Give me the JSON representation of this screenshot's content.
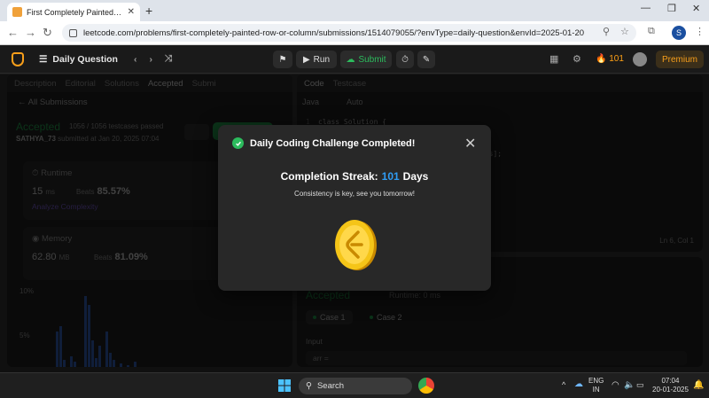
{
  "browser": {
    "tab_title": "First Completely Painted Row o",
    "url": "leetcode.com/problems/first-completely-painted-row-or-column/submissions/1514079055/?envType=daily-question&envId=2025-01-20",
    "profile_initial": "S"
  },
  "header": {
    "title": "Daily Question",
    "run_label": "Run",
    "submit_label": "Submit",
    "streak_count": "101",
    "premium_label": "Premium"
  },
  "left_panel": {
    "tabs": [
      "Description",
      "Editorial",
      "Solutions",
      "Accepted",
      "Submi"
    ],
    "all_submissions": "All Submissions",
    "status": "Accepted",
    "testcases": "1056 / 1056 testcases passed",
    "user": "SATHYA_73",
    "submitted_at": "submitted at Jan 20, 2025 07:04",
    "runtime": {
      "title": "Runtime",
      "value": "15",
      "unit": "ms",
      "beats_label": "Beats",
      "beats": "85.57%",
      "analyze": "Analyze Complexity"
    },
    "memory": {
      "title": "Memory",
      "value": "62.80",
      "unit": "MB",
      "beats_label": "Beats",
      "beats": "81.09%"
    },
    "chart_ticks": [
      "10%",
      "5%"
    ]
  },
  "editor": {
    "tabs": [
      "Code",
      "Testcase"
    ],
    "language": "Java",
    "mode": "Auto",
    "lines": [
      {
        "n": "1",
        "text": "class Solution {"
      },
      {
        "n": "",
        "text": "                    arr, int[][] mat) {"
      },
      {
        "n": "",
        "text": "                   t[0].length;"
      },
      {
        "n": "",
        "text": "                   olCount = new int[cols];"
      },
      {
        "n": "",
        "text": "                   * cols + 1][2];"
      },
      {
        "n": "",
        "text": ""
      },
      {
        "n": "",
        "text": ""
      },
      {
        "n": "",
        "text": "                   ) {"
      },
      {
        "n": "",
        "text": "                   w int[]{i, j};"
      }
    ],
    "cursor": "Ln 6, Col 1"
  },
  "result": {
    "status": "Accepted",
    "runtime": "Runtime: 0 ms",
    "cases": [
      "Case 1",
      "Case 2"
    ],
    "input_label": "Input",
    "input_value": "arr ="
  },
  "modal": {
    "title": "Daily Coding Challenge Completed!",
    "streak_label": "Completion Streak:",
    "streak_value": "101",
    "streak_unit": "Days",
    "message": "Consistency is key, see you tomorrow!"
  },
  "taskbar": {
    "search_label": "Search",
    "lang_top": "ENG",
    "lang_bottom": "IN",
    "time": "07:04",
    "date": "20-01-2025"
  }
}
